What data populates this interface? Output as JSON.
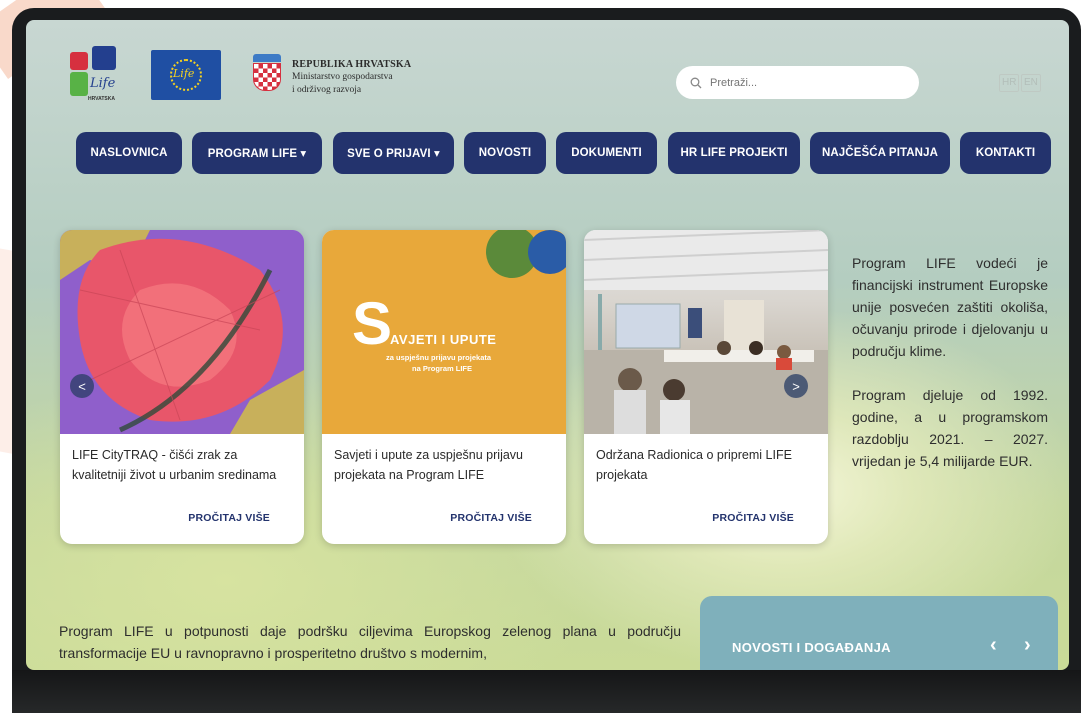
{
  "header": {
    "life_logo_text": "Life",
    "life_logo_sub": "HRVATSKA",
    "eu_logo_text": "Life",
    "gov_line1": "REPUBLIKA HRVATSKA",
    "gov_line2": "Ministarstvo gospodarstva",
    "gov_line3": "i održivog razvoja",
    "search_placeholder": "Pretraži...",
    "lang_hr": "HR",
    "lang_en": "EN"
  },
  "nav": {
    "items": [
      {
        "label": "NASLOVNICA"
      },
      {
        "label": "PROGRAM LIFE ▾"
      },
      {
        "label": "SVE O PRIJAVI ▾"
      },
      {
        "label": "NOVOSTI"
      },
      {
        "label": "DOKUMENTI"
      },
      {
        "label": "HR LIFE PROJEKTI"
      },
      {
        "label": "NAJČEŠĆA PITANJA"
      },
      {
        "label": "KONTAKTI"
      }
    ]
  },
  "cards": [
    {
      "title": "LIFE CityTRAQ - čišći zrak za kvalitetniji život u urbanim sredinama",
      "more": "PROČITAJ VIŠE"
    },
    {
      "title": "Savjeti i upute za uspješnu prijavu projekata na Program LIFE",
      "more": "PROČITAJ VIŠE",
      "image_big_letter": "S",
      "image_heading": "AVJETI I UPUTE",
      "image_sub1": "za uspješnu prijavu projekata",
      "image_sub2": "na Program LIFE"
    },
    {
      "title": "Održana Radionica o pripremi LIFE projekata",
      "more": "PROČITAJ VIŠE"
    }
  ],
  "carousel": {
    "prev": "<",
    "next": ">"
  },
  "side_text": {
    "p1": "Program LIFE vodeći je financijski instrument Europske unije posvećen zaštiti okoliša, očuvanju prirode i djelovanju u području klime.",
    "p2": "Program djeluje od 1992. godine, a u programskom razdoblju 2021. – 2027. vrijedan je 5,4 milijarde EUR."
  },
  "bottom_text": "Program LIFE u potpunosti daje podršku ciljevima Europskog zelenog plana u području transformacije EU u ravnopravno i prosperitetno društvo s modernim,",
  "news": {
    "heading": "NOVOSTI I DOGAĐANJA",
    "prev": "‹",
    "next": "›"
  },
  "colors": {
    "nav_bg": "#23336d",
    "news_bg": "#7fb0bb",
    "card_yellow": "#e8a83a"
  }
}
